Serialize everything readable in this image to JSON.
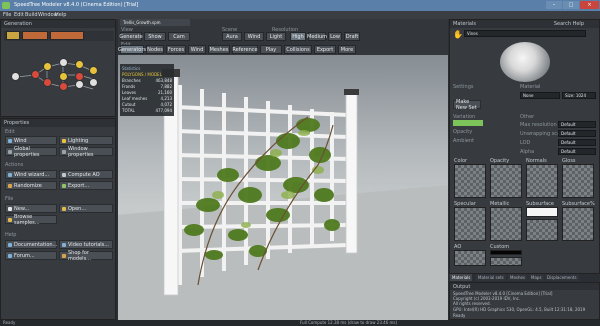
{
  "window": {
    "title": "SpeedTree Modeler v8.4.0 (Cinema Edition) [Trial]"
  },
  "menu": [
    "File",
    "Edit",
    "Build",
    "Window",
    "Help"
  ],
  "generation": {
    "title": "Generation"
  },
  "doc_tab": "Trellis_Growth.spm",
  "toolbar": {
    "view_label": "View",
    "scene_label": "Scene",
    "resolution_label": "Resolution",
    "edit_label": "Edit",
    "view_buttons": [
      "Generate",
      "Show",
      "Cam"
    ],
    "scene_buttons": [
      "Aura",
      "Wind",
      "Light"
    ],
    "res_buttons": [
      "High",
      "Medium",
      "Low",
      "Draft"
    ],
    "edit_buttons": [
      "Generators",
      "Nodes",
      "Forces",
      "Wind",
      "Meshes",
      "Reference"
    ],
    "edit_right": [
      "Play",
      "Collisions",
      "Export",
      "More"
    ]
  },
  "stats": {
    "title": "Statistics",
    "header": "POLYGONS / MODEL",
    "rows": [
      {
        "k": "Branches",
        "v": "463,848"
      },
      {
        "k": "Fronds",
        "v": "7,882"
      },
      {
        "k": "Leaves",
        "v": "21,160"
      },
      {
        "k": "Leaf meshes",
        "v": "4,213"
      },
      {
        "k": "Cutout",
        "v": "4,072"
      },
      {
        "k": "TOTAL",
        "v": "477,094"
      },
      {
        "k": "Bones",
        "v": "1,689"
      }
    ]
  },
  "properties": {
    "title": "Properties",
    "edit_label": "Edit",
    "edit_buttons": [
      "Wind",
      "Lighting",
      "Global properties",
      "Window properties"
    ],
    "actions_label": "Actions",
    "action_buttons": [
      "Wind wizard...",
      "Compute AO",
      "Randomize",
      "Export..."
    ],
    "file_label": "File",
    "file_buttons": [
      "New...",
      "Open...",
      "Browse samples..."
    ],
    "help_label": "Help",
    "help_buttons": [
      "Documentation...",
      "Video tutorials...",
      "Forum...",
      "Shop for models..."
    ]
  },
  "materials": {
    "title": "Materials",
    "search_help": "Search Help",
    "selected": "Vines",
    "settings_label": "Settings",
    "make_new_set": "Make New Set",
    "opacity_label": "Opacity",
    "ambient_label": "Ambient",
    "material_label": "Material",
    "material_value": "None",
    "stats_size": "Size: 1024",
    "variation_label": "Variation",
    "other_label": "Other",
    "max_resolution_label": "Max resolution",
    "max_resolution": "Default",
    "unwrapping_label": "Unwrapping scale",
    "unwrapping": "Default",
    "lod_label": "LOD",
    "lod_value": "Default",
    "alpha_label": "Alpha",
    "alpha_value": "Default",
    "map_labels": [
      "Color",
      "Opacity",
      "Normals",
      "Gloss",
      "Specular",
      "Metallic",
      "Subsurface",
      "Subsurface%",
      "AO",
      "Custom"
    ],
    "tabs": [
      "Materials",
      "Material sets",
      "Meshes",
      "Maps",
      "Displacements"
    ]
  },
  "output": {
    "title": "Output",
    "lines": [
      "SpeedTree Modeler v8.4.0 [Cinema Edition] [Trial]",
      "Copyright (c) 2003-2019 IDV, Inc.",
      "All rights reserved.",
      "GPU: Intel(R) HD Graphics 530, OpenGL: 4.5, Built 12:31:18, 2019",
      "Ready"
    ]
  },
  "status": {
    "text": "Ready",
    "viewport": "Full Compute 12.38 ms (draw to draw 23.46 ms)"
  }
}
